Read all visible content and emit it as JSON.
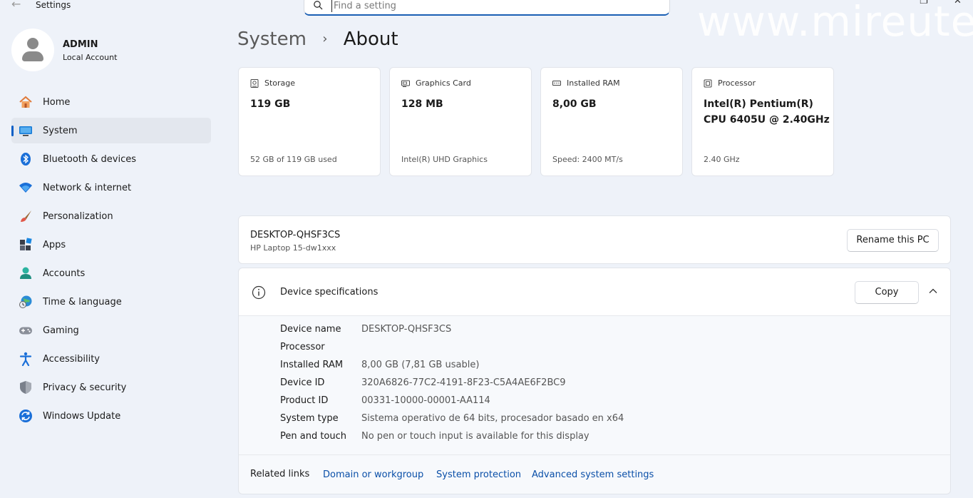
{
  "window": {
    "title": "Settings",
    "back_glyph": "←",
    "restore_glyph": "❐",
    "close_glyph": "✕"
  },
  "search": {
    "placeholder": "Find a setting"
  },
  "watermark": "www.mireute",
  "profile": {
    "name": "ADMIN",
    "account_type": "Local Account"
  },
  "nav": {
    "items": [
      {
        "label": "Home",
        "icon": "home-icon"
      },
      {
        "label": "System",
        "icon": "system-icon",
        "active": true
      },
      {
        "label": "Bluetooth & devices",
        "icon": "bluetooth-icon"
      },
      {
        "label": "Network & internet",
        "icon": "wifi-icon"
      },
      {
        "label": "Personalization",
        "icon": "brush-icon"
      },
      {
        "label": "Apps",
        "icon": "apps-icon"
      },
      {
        "label": "Accounts",
        "icon": "account-icon"
      },
      {
        "label": "Time & language",
        "icon": "globe-clock-icon"
      },
      {
        "label": "Gaming",
        "icon": "gamepad-icon"
      },
      {
        "label": "Accessibility",
        "icon": "accessibility-icon"
      },
      {
        "label": "Privacy & security",
        "icon": "shield-icon"
      },
      {
        "label": "Windows Update",
        "icon": "update-icon"
      }
    ]
  },
  "breadcrumb": {
    "parent": "System",
    "separator": "›",
    "current": "About"
  },
  "cards": [
    {
      "title": "Storage",
      "value": "119 GB",
      "sub": "52 GB of 119 GB used",
      "icon": "storage-icon"
    },
    {
      "title": "Graphics Card",
      "value": "128 MB",
      "sub": "Intel(R) UHD Graphics",
      "icon": "gpu-icon"
    },
    {
      "title": "Installed RAM",
      "value": "8,00 GB",
      "sub": "Speed: 2400 MT/s",
      "icon": "ram-icon"
    },
    {
      "title": "Processor",
      "value": "Intel(R) Pentium(R) CPU 6405U @ 2.40GHz",
      "sub": "2.40 GHz",
      "icon": "cpu-icon"
    }
  ],
  "pc": {
    "name": "DESKTOP-QHSF3CS",
    "model": "HP Laptop 15-dw1xxx",
    "rename_label": "Rename this PC"
  },
  "specs": {
    "title": "Device specifications",
    "copy_label": "Copy",
    "rows": [
      {
        "label": "Device name",
        "value": "DESKTOP-QHSF3CS"
      },
      {
        "label": "Processor",
        "value": ""
      },
      {
        "label": "Installed RAM",
        "value": "8,00 GB (7,81 GB usable)"
      },
      {
        "label": "Device ID",
        "value": "320A6826-77C2-4191-8F23-C5A4AE6F2BC9"
      },
      {
        "label": "Product ID",
        "value": "00331-10000-00001-AA114"
      },
      {
        "label": "System type",
        "value": "Sistema operativo de 64 bits, procesador basado en x64"
      },
      {
        "label": "Pen and touch",
        "value": "No pen or touch input is available for this display"
      }
    ]
  },
  "related": {
    "label": "Related links",
    "links": [
      "Domain or workgroup",
      "System protection",
      "Advanced system settings"
    ]
  },
  "colors": {
    "accent": "#0a5fc6",
    "link": "#0a4fa8",
    "background": "#eef2f9"
  }
}
